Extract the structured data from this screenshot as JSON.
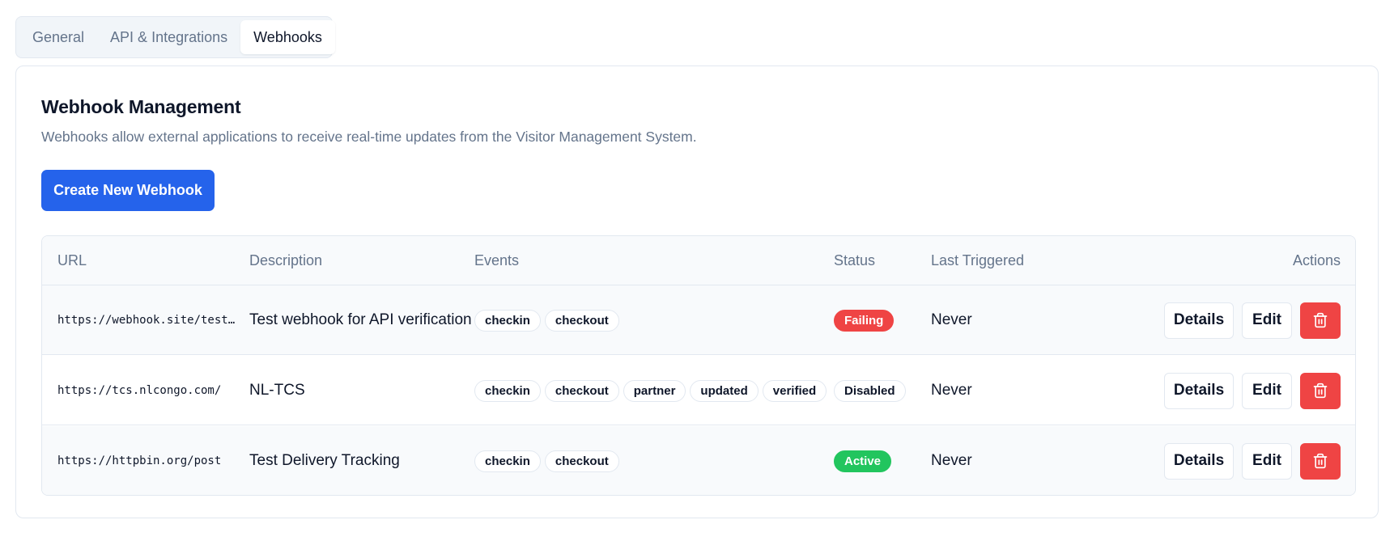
{
  "tabs": [
    {
      "label": "General",
      "active": false
    },
    {
      "label": "API & Integrations",
      "active": false
    },
    {
      "label": "Webhooks",
      "active": true
    }
  ],
  "card": {
    "title": "Webhook Management",
    "description": "Webhooks allow external applications to receive real-time updates from the Visitor Management System.",
    "create_label": "Create New Webhook"
  },
  "table": {
    "headers": {
      "url": "URL",
      "description": "Description",
      "events": "Events",
      "status": "Status",
      "last_triggered": "Last Triggered",
      "actions": "Actions"
    },
    "rows": [
      {
        "url": "https://webhook.site/test…",
        "description": "Test webhook for API verification",
        "events": [
          "checkin",
          "checkout"
        ],
        "status": "Failing",
        "last_triggered": "Never"
      },
      {
        "url": "https://tcs.nlcongo.com/",
        "description": "NL-TCS",
        "events": [
          "checkin",
          "checkout",
          "partner",
          "updated",
          "verified"
        ],
        "status": "Disabled",
        "last_triggered": "Never"
      },
      {
        "url": "https://httpbin.org/post",
        "description": "Test Delivery Tracking",
        "events": [
          "checkin",
          "checkout"
        ],
        "status": "Active",
        "last_triggered": "Never"
      }
    ],
    "action_labels": {
      "details": "Details",
      "edit": "Edit",
      "delete_icon": "trash-icon"
    }
  },
  "colors": {
    "primary": "#2563eb",
    "danger": "#ef4444",
    "success": "#22c55e",
    "muted_text": "#64748b",
    "border": "#e2e8f0"
  }
}
